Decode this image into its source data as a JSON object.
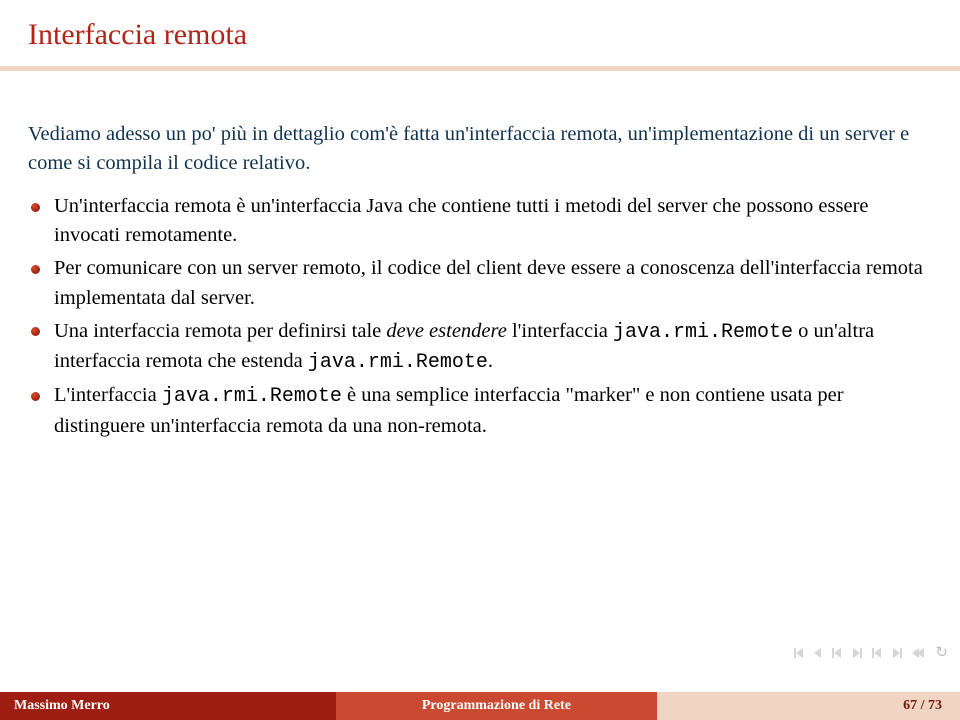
{
  "title": "Interfaccia remota",
  "intro": "Vediamo adesso un po' più in dettaglio com'è fatta un'interfaccia remota, un'implementazione di un server e come si compila il codice relativo.",
  "bullets": {
    "b1": "Un'interfaccia remota è un'interfaccia Java che contiene tutti i metodi del server che possono essere invocati remotamente.",
    "b2": "Per comunicare con un server remoto, il codice del client deve essere a conoscenza dell'interfaccia remota implementata dal server.",
    "b3a": "Una interfaccia remota per definirsi tale ",
    "b3em": "deve estendere",
    "b3b": " l'interfaccia ",
    "b3c1": "java.rmi.Remote",
    "b3d": " o un'altra interfaccia remota che estenda ",
    "b3c2": "java.rmi.Remote",
    "b3e": ".",
    "b4a": "L'interfaccia ",
    "b4c": "java.rmi.Remote",
    "b4b": " è una semplice interfaccia \"marker\" e non contiene usata per distinguere un'interfaccia remota da una non-remota."
  },
  "footer": {
    "author": "Massimo Merro",
    "topic": "Programmazione di Rete",
    "page": "67 / 73"
  }
}
